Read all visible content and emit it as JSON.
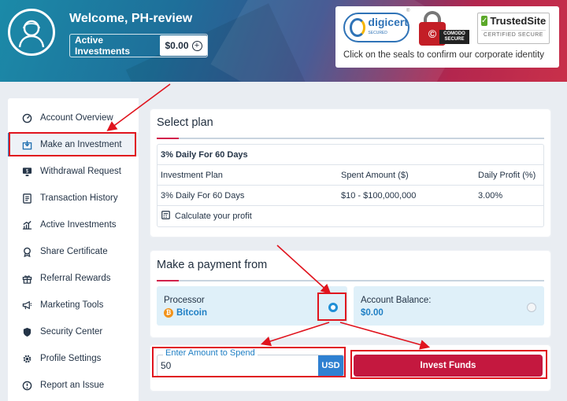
{
  "header": {
    "welcome": "Welcome, PH-review",
    "active_investments_label": "Active Investments",
    "active_investments_value": "$0.00"
  },
  "seals": {
    "digicert": "digicert",
    "digicert_sub": "SECURED",
    "comodo": "COMODO SECURE",
    "trusted": "TrustedSite",
    "trusted_sub": "CERTIFIED SECURE",
    "caption": "Click on the seals to confirm our corporate identity"
  },
  "sidebar": {
    "items": [
      {
        "label": "Account Overview",
        "icon": "dashboard-icon"
      },
      {
        "label": "Make an Investment",
        "icon": "download-box-icon",
        "active": true
      },
      {
        "label": "Withdrawal Request",
        "icon": "monitor-dollar-icon"
      },
      {
        "label": "Transaction History",
        "icon": "document-list-icon"
      },
      {
        "label": "Active Investments",
        "icon": "growth-chart-icon"
      },
      {
        "label": "Share Certificate",
        "icon": "certificate-badge-icon"
      },
      {
        "label": "Referral Rewards",
        "icon": "gift-icon"
      },
      {
        "label": "Marketing Tools",
        "icon": "megaphone-icon"
      },
      {
        "label": "Security Center",
        "icon": "shield-icon"
      },
      {
        "label": "Profile Settings",
        "icon": "gear-icon"
      },
      {
        "label": "Report an Issue",
        "icon": "alert-circle-icon"
      }
    ]
  },
  "select_plan": {
    "title": "Select plan",
    "plan_name": "3% Daily For 60 Days",
    "columns": [
      "Investment Plan",
      "Spent Amount ($)",
      "Daily Profit (%)"
    ],
    "row": [
      "3% Daily For 60 Days",
      "$10 - $100,000,000",
      "3.00%"
    ],
    "calculate_label": "Calculate your profit"
  },
  "payment": {
    "title": "Make a payment from",
    "processor_label": "Processor",
    "processor_value": "Bitcoin",
    "balance_label": "Account Balance:",
    "balance_value": "$0.00"
  },
  "amount": {
    "legend": "Enter Amount to Spend",
    "value": "50",
    "currency": "USD"
  },
  "invest_button": "Invest Funds",
  "colors": {
    "accent_red": "#d2224b",
    "accent_blue": "#1f8fd6",
    "annotation_red": "#e0141e"
  }
}
